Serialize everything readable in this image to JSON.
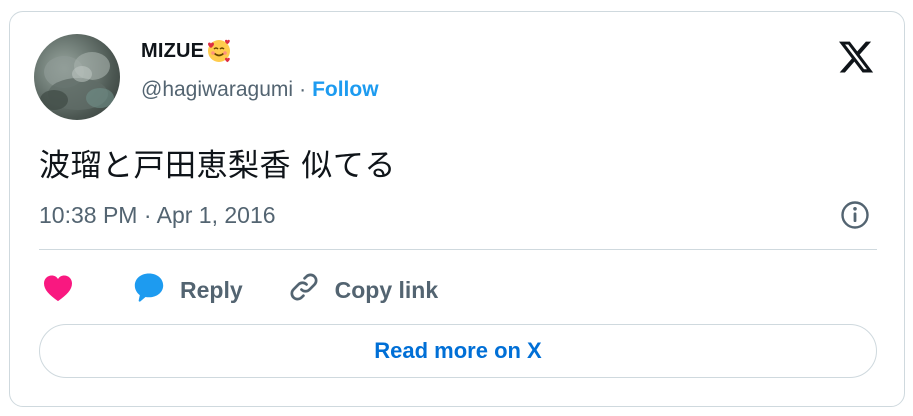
{
  "author": {
    "display_name": "MIZUE",
    "handle": "@hagiwaragumi",
    "separator": "·",
    "follow_label": "Follow"
  },
  "tweet": {
    "text": "波瑠と戸田恵梨香 似てる",
    "timestamp": "10:38 PM · Apr 1, 2016"
  },
  "actions": {
    "reply_label": "Reply",
    "copy_link_label": "Copy link"
  },
  "read_more_label": "Read more on X",
  "icons": {
    "emoji": "smiling-face-with-hearts-icon",
    "logo": "x-logo-icon",
    "info": "info-icon",
    "like": "heart-icon",
    "reply": "speech-bubble-icon",
    "copy": "link-icon"
  },
  "colors": {
    "link_blue": "#1d9bf0",
    "read_more_blue": "#006fd6",
    "like_pink": "#f91880",
    "reply_blue": "#1d9bf0",
    "secondary_text": "#536471",
    "border": "#cfd9de"
  }
}
